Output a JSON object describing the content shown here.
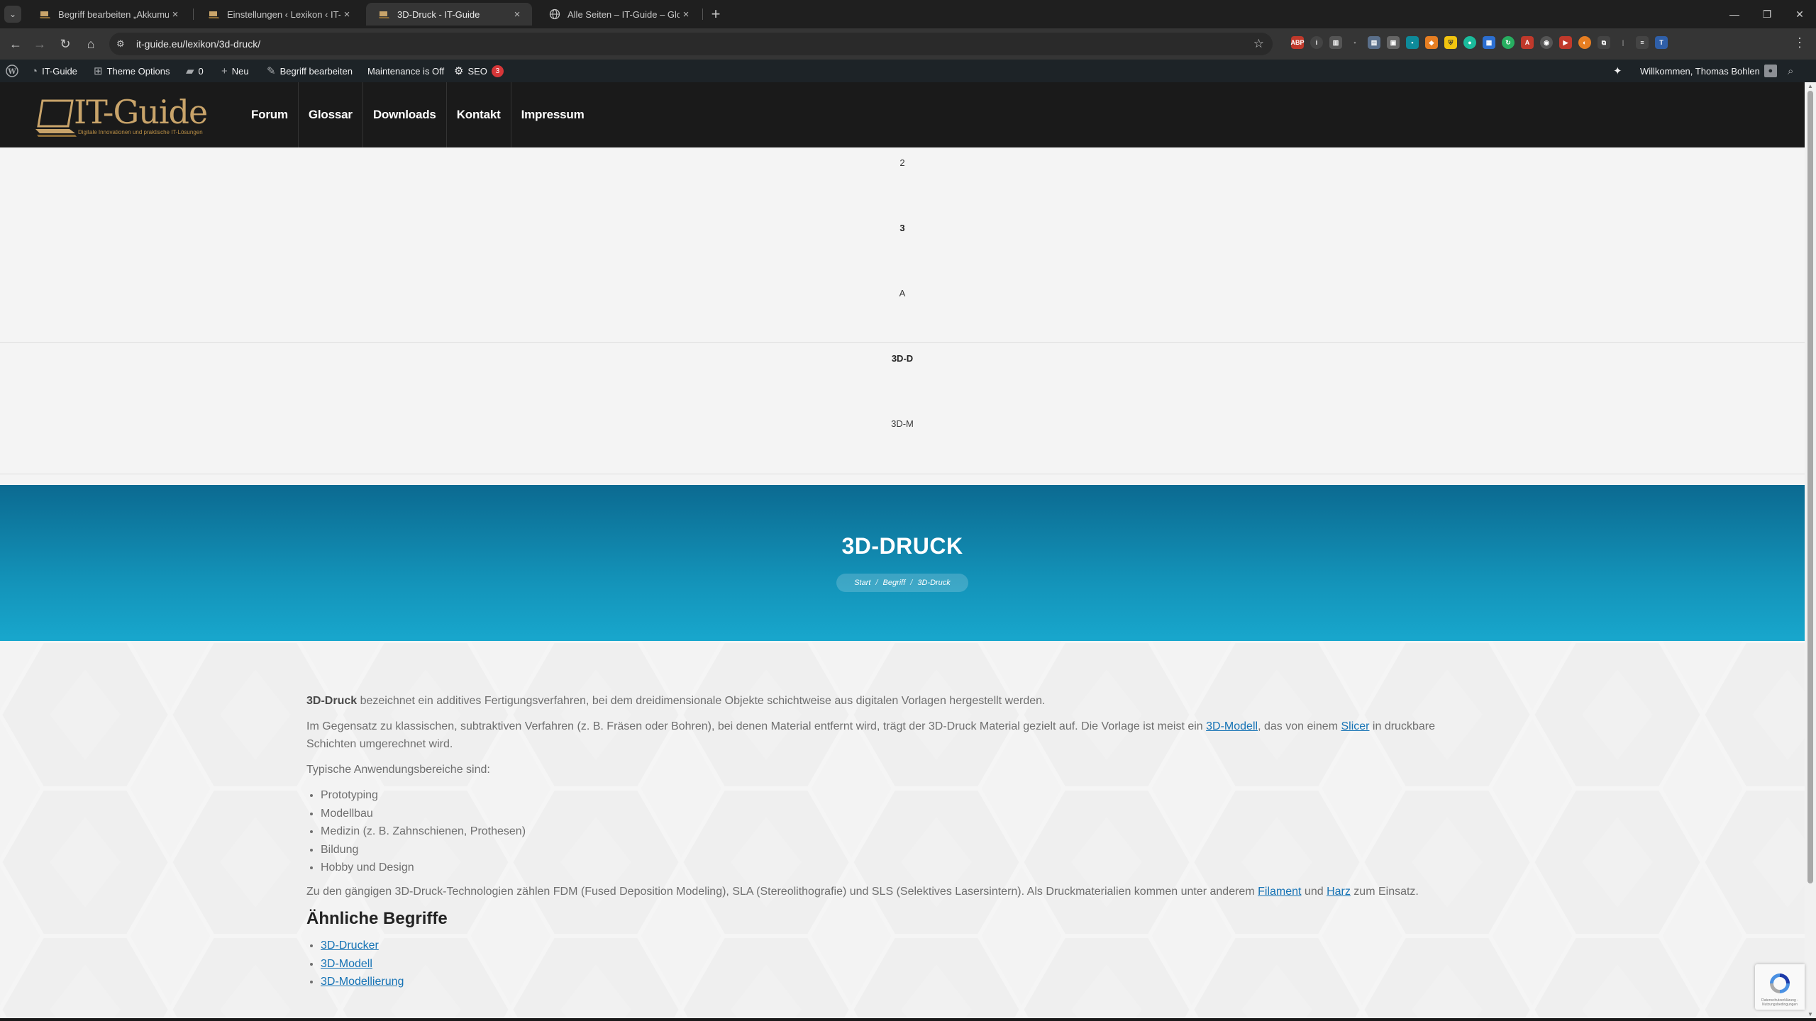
{
  "browser": {
    "tabs": [
      {
        "title": "Begriff bearbeiten „Akkumulator",
        "active": false
      },
      {
        "title": "Einstellungen ‹ Lexikon ‹ IT-Guide",
        "active": false
      },
      {
        "title": "3D-Druck - IT-Guide",
        "active": true
      },
      {
        "title": "Alle Seiten – IT-Guide – Glossar",
        "active": false
      }
    ],
    "url": "it-guide.eu/lexikon/3d-druck/",
    "new_tab_symbol": "+",
    "close_symbol": "×"
  },
  "admin_bar": {
    "site_name": "IT-Guide",
    "theme_options": "Theme Options",
    "comments_count": "0",
    "new_label": "Neu",
    "edit_term": "Begriff bearbeiten",
    "maintenance": "Maintenance is Off",
    "seo_label": "SEO",
    "seo_count": "3",
    "welcome": "Willkommen, Thomas Bohlen"
  },
  "header": {
    "logo_text": "IT-Guide",
    "logo_tagline": "Digitale Innovationen und praktische IT-Lösungen",
    "nav": [
      "Forum",
      "Glossar",
      "Downloads",
      "Kontakt",
      "Impressum"
    ]
  },
  "letter_nav": {
    "row1": [
      "2",
      "3",
      "A"
    ],
    "row2": [
      "3D-D",
      "3D-M"
    ]
  },
  "hero": {
    "title": "3D-DRUCK",
    "breadcrumb": [
      "Start",
      "Begriff",
      "3D-Druck"
    ],
    "breadcrumb_sep": "/"
  },
  "article": {
    "p1_term": "3D-Druck",
    "p1_rest": " bezeichnet ein additives Fertigungsverfahren, bei dem dreidimensionale Objekte schichtweise aus digitalen Vorlagen hergestellt werden.",
    "p2_a": "Im Gegensatz zu klassischen, subtraktiven Verfahren (z. B. Fräsen oder Bohren), bei denen Material entfernt wird, trägt der 3D-Druck Material gezielt auf. Die Vorlage ist meist ein ",
    "p2_link1": "3D-Modell",
    "p2_b": ", das von einem ",
    "p2_link2": "Slicer",
    "p2_c": " in druckbare Schichten umgerechnet wird.",
    "p3": "Typische Anwendungsbereiche sind:",
    "applications": [
      "Prototyping",
      "Modellbau",
      "Medizin (z. B. Zahnschienen, Prothesen)",
      "Bildung",
      "Hobby und Design"
    ],
    "p4_a": "Zu den gängigen 3D-Druck-Technologien zählen FDM (Fused Deposition Modeling), SLA (Stereolithografie) und SLS (Selektives Lasersintern). Als Druckmaterialien kommen unter anderem ",
    "p4_link1": "Filament",
    "p4_b": " und ",
    "p4_link2": "Harz",
    "p4_c": " zum Einsatz.",
    "related_heading": "Ähnliche Begriffe",
    "related": [
      "3D-Drucker",
      "3D-Modell",
      "3D-Modellierung"
    ]
  },
  "recaptcha": {
    "text": "Datenschutzerklärung - Nutzungsbedingungen"
  },
  "colors": {
    "hero_top": "#0b6a91",
    "hero_bottom": "#18a7cd",
    "link": "#1673b5",
    "header_bg": "#1a1a1a",
    "logo_gold": "#c9a46a",
    "admin_bar": "#1d2327"
  },
  "icons": [
    "wordpress-icon",
    "dashboard-icon",
    "theme-options-icon",
    "comment-icon",
    "plus-icon",
    "pencil-icon",
    "seo-icon",
    "ai-sparkle-icon",
    "user-icon",
    "search-icon",
    "star-icon",
    "back-icon",
    "forward-icon",
    "reload-icon",
    "home-icon",
    "site-info-icon",
    "menu-icon",
    "recaptcha-icon"
  ]
}
